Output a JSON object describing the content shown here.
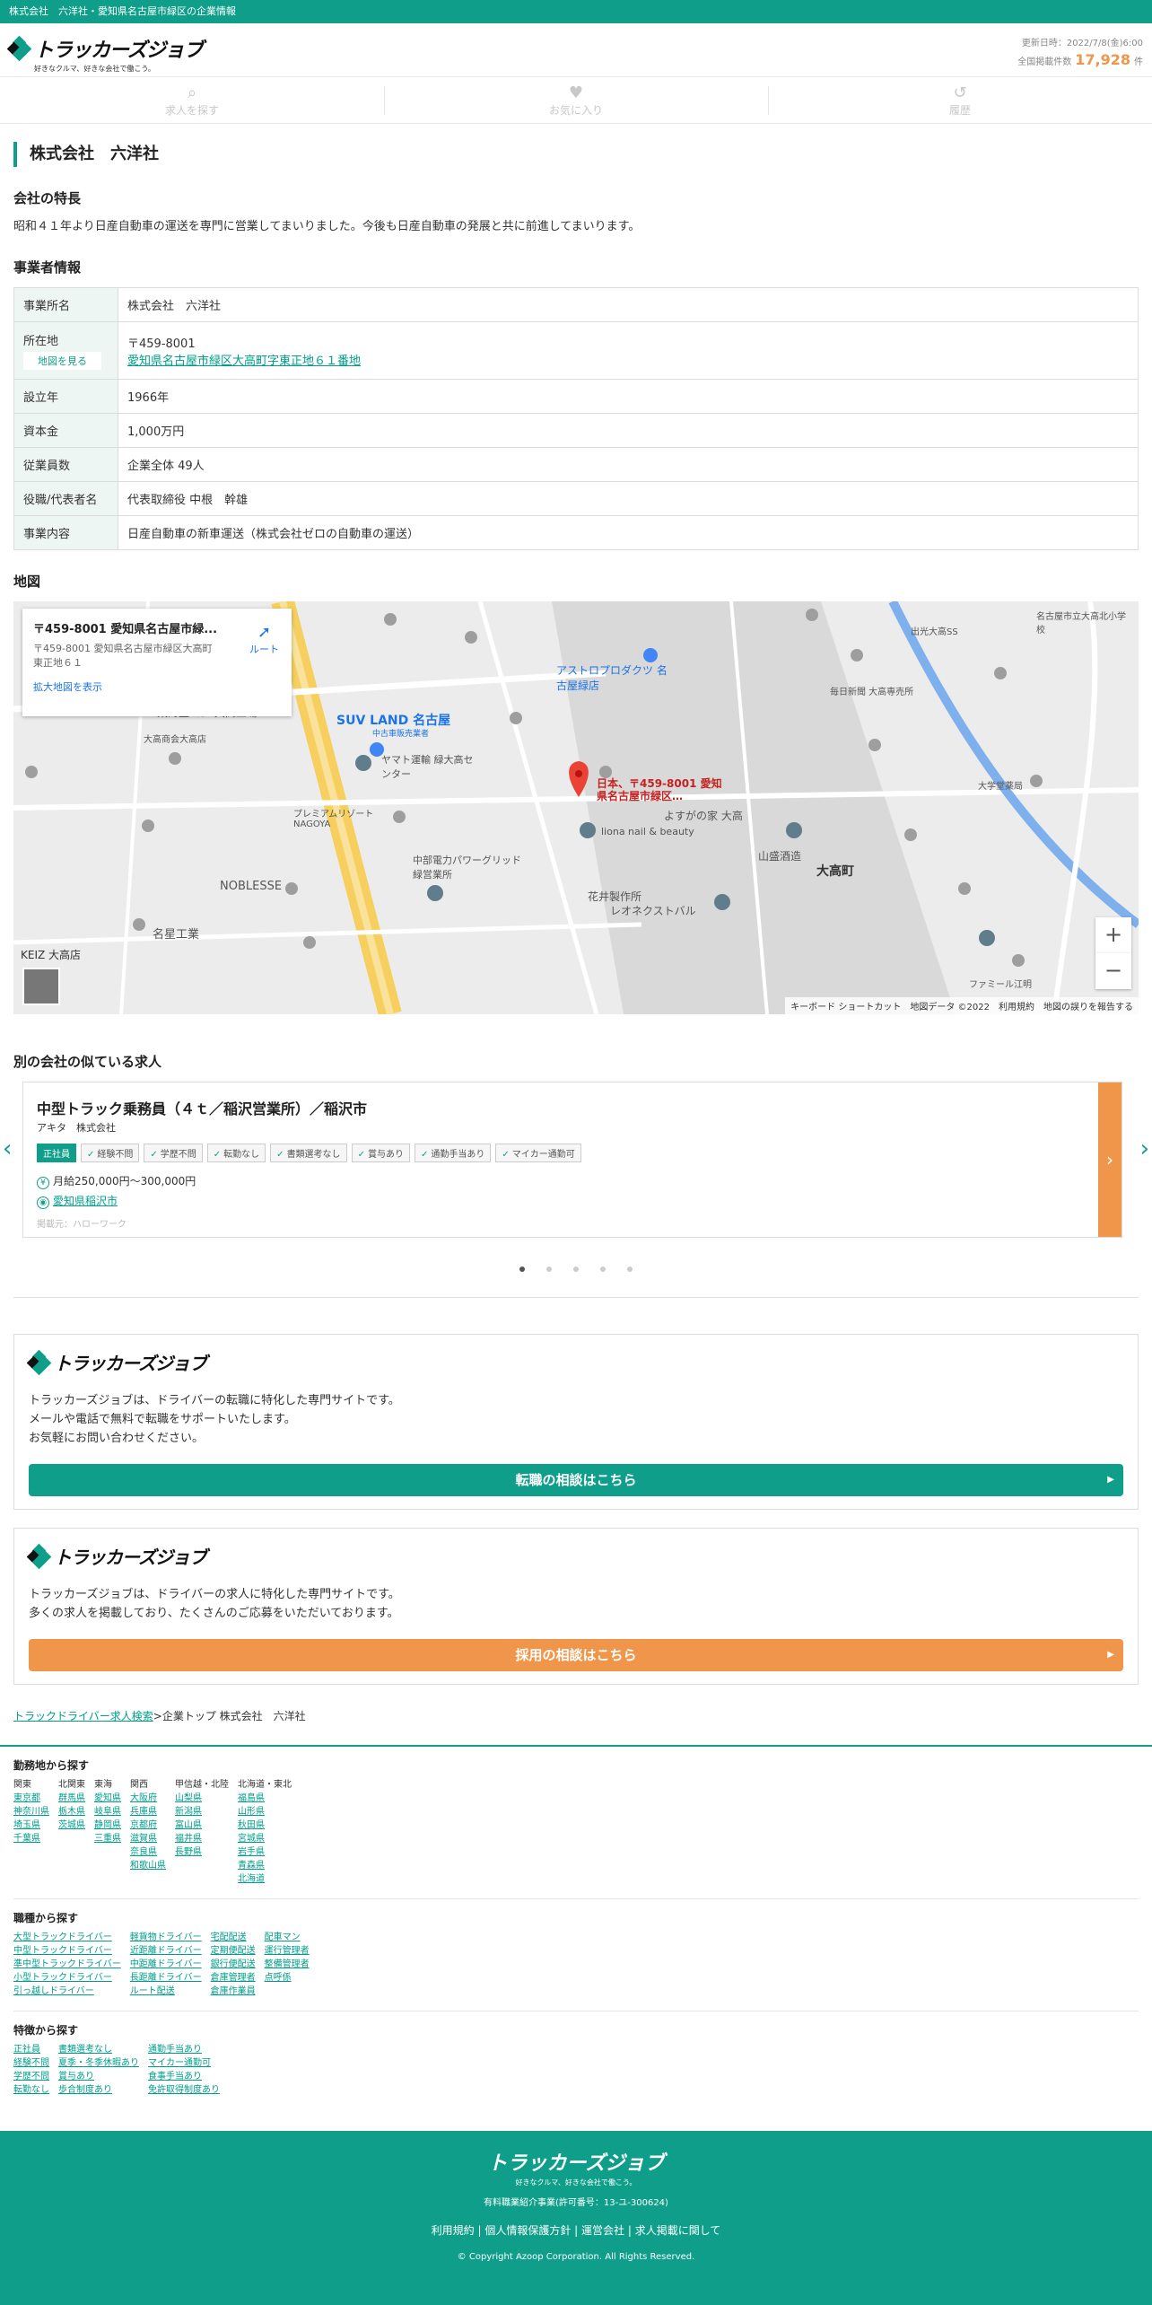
{
  "topbar": {
    "text": "株式会社　六洋社・愛知県名古屋市緑区の企業情報"
  },
  "header": {
    "logo_text": "トラッカーズジョブ",
    "logo_sub": "好きなクルマ、好きな会社で働こう。",
    "updated": "更新日時：2022/7/8(金)6:00",
    "count_label": "全国掲載件数",
    "count": "17,928",
    "count_unit": "件"
  },
  "nav": [
    {
      "label": "求人を探す",
      "icon": "search-icon",
      "glyph": "⌕"
    },
    {
      "label": "お気に入り",
      "icon": "heart-icon",
      "glyph": "♥"
    },
    {
      "label": "履歴",
      "icon": "history-icon",
      "glyph": "↺"
    }
  ],
  "company": {
    "name": "株式会社　六洋社"
  },
  "features": {
    "heading": "会社の特長",
    "text": "昭和４１年より日産自動車の運送を専門に営業してまいりました。今後も日産自動車の発展と共に前進してまいります。"
  },
  "info": {
    "heading": "事業者情報",
    "office_label": "事業所名",
    "office": "株式会社　六洋社",
    "location_label": "所在地",
    "map_button": "地図を見る",
    "zip": "〒459-8001",
    "address": "愛知県名古屋市緑区大高町字東正地６１番地",
    "founded_label": "設立年",
    "founded": "1966年",
    "capital_label": "資本金",
    "capital": "1,000万円",
    "employees_label": "従業員数",
    "employees": "企業全体 49人",
    "rep_label": "役職/代表者名",
    "rep": "代表取締役 中根　幹雄",
    "business_label": "事業内容",
    "business": "日産自動車の新車運送（株式会社ゼロの自動車の運送）"
  },
  "map": {
    "heading": "地図",
    "card_title": "〒459-8001 愛知県名古屋市緑...",
    "card_address": "〒459-8001 愛知県名古屋市緑区大高町東正地６１",
    "card_link": "拡大地図を表示",
    "route": "ルート",
    "marker_label": "日本、〒459-8001 愛知県名古屋市緑区…",
    "zoom_in": "+",
    "zoom_out": "−",
    "labels": [
      "SUV LAND 名古屋",
      "中古車販売業者",
      "ヤマト運輸 緑大高センター",
      "アストロプロダクツ 名古屋緑店",
      "東海生コン 大高工場",
      "大高商会大高店",
      "プレミアムリゾート NAGOYA",
      "中部電力パワーグリッド 緑営業所",
      "NOBLESSE",
      "名星工業",
      "KEIZ 大高店",
      "大高町",
      "山盛酒造",
      "花井製作所",
      "レオネクストバル",
      "よすがの家 大高",
      "ファミール江明",
      "liona nail & beauty",
      "名古屋市立大高北小学校",
      "出光大高SS",
      "毎日新聞 大高専売所",
      "大学堂薬局"
    ],
    "footer": "キーボード ショートカット　地図データ ©2022　利用規約　地図の誤りを報告する"
  },
  "similar": {
    "heading": "別の会社の似ている求人",
    "title": "中型トラック乗務員（４ｔ／稲沢営業所）／稲沢市",
    "company": "アキタ　株式会社",
    "tags": [
      "正社員",
      "経験不問",
      "学歴不問",
      "転勤なし",
      "書類選考なし",
      "賞与あり",
      "通勤手当あり",
      "マイカー通勤可"
    ],
    "salary": "月給250,000円〜300,000円",
    "location": "愛知県稲沢市",
    "source": "掲載元：ハローワーク"
  },
  "promo1": {
    "text1": "トラッカーズジョブは、ドライバーの転職に特化した専門サイトです。",
    "text2": "メールや電話で無料で転職をサポートいたします。",
    "text3": "お気軽にお問い合わせください。",
    "button": "転職の相談はこちら",
    "button_color": "#0e9e8a"
  },
  "promo2": {
    "text1": "トラッカーズジョブは、ドライバーの求人に特化した専門サイトです。",
    "text2": "多くの求人を掲載しており、たくさんのご応募をいただいております。",
    "button": "採用の相談はこちら",
    "button_color": "#f0964b"
  },
  "breadcrumb": {
    "link": "トラックドライバー求人検索",
    "current": ">企業トップ 株式会社　六洋社"
  },
  "search_area": {
    "title": "勤務地から探す",
    "cols": [
      {
        "head": "関東",
        "items": [
          "東京都",
          "神奈川県",
          "埼玉県",
          "千葉県"
        ]
      },
      {
        "head": "北関東",
        "items": [
          "群馬県",
          "栃木県",
          "茨城県"
        ]
      },
      {
        "head": "東海",
        "items": [
          "愛知県",
          "岐阜県",
          "静岡県",
          "三重県"
        ]
      },
      {
        "head": "関西",
        "items": [
          "大阪府",
          "兵庫県",
          "京都府",
          "滋賀県",
          "奈良県",
          "和歌山県"
        ]
      },
      {
        "head": "甲信越・北陸",
        "items": [
          "山梨県",
          "新潟県",
          "富山県",
          "福井県",
          "長野県"
        ]
      },
      {
        "head": "北海道・東北",
        "items": [
          "福島県",
          "山形県",
          "秋田県",
          "宮城県",
          "岩手県",
          "青森県",
          "北海道"
        ]
      }
    ]
  },
  "search_job": {
    "title": "職種から探す",
    "cols": [
      {
        "items": [
          "大型トラックドライバー",
          "中型トラックドライバー",
          "準中型トラックドライバー",
          "小型トラックドライバー",
          "引っ越しドライバー"
        ]
      },
      {
        "items": [
          "軽貨物ドライバー",
          "近距離ドライバー",
          "中距離ドライバー",
          "長距離ドライバー",
          "ルート配送"
        ]
      },
      {
        "items": [
          "宅配配送",
          "定期便配送",
          "銀行便配送",
          "倉庫管理者",
          "倉庫作業員"
        ]
      },
      {
        "items": [
          "配車マン",
          "運行管理者",
          "整備管理者",
          "点呼係"
        ]
      }
    ]
  },
  "search_feature": {
    "title": "特徴から探す",
    "cols": [
      {
        "items": [
          "正社員",
          "経験不問",
          "学歴不問",
          "転勤なし"
        ]
      },
      {
        "items": [
          "書類選考なし",
          "夏季・冬季休暇あり",
          "賞与あり",
          "歩合制度あり"
        ]
      },
      {
        "items": [
          "通勤手当あり",
          "マイカー通勤可",
          "食事手当あり",
          "免許取得制度あり"
        ]
      }
    ]
  },
  "footer": {
    "logo": "トラッカーズジョブ",
    "sub": "好きなクルマ、好きな会社で働こう。",
    "license": "有料職業紹介事業(許可番号：13-ユ-300624)",
    "links": [
      "利用規約",
      "個人情報保護方針",
      "運営会社",
      "求人掲載に関して"
    ],
    "copyright": "© Copyright Azoop Corporation. All Rights Reserved."
  }
}
